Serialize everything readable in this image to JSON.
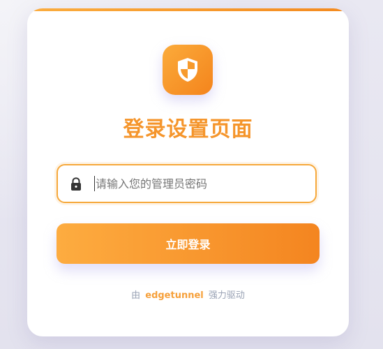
{
  "colors": {
    "accent": "#f5952b",
    "accent_start": "#fdac40",
    "accent_end": "#f48520",
    "footer_text": "#9aa3b5"
  },
  "logo": {
    "icon": "shield-icon"
  },
  "title": "登录设置页面",
  "password_field": {
    "icon": "lock-icon",
    "placeholder": "请输入您的管理员密码",
    "value": ""
  },
  "login_button": {
    "label": "立即登录"
  },
  "footer": {
    "prefix": "由",
    "link": "edgetunnel",
    "suffix": "强力驱动"
  }
}
